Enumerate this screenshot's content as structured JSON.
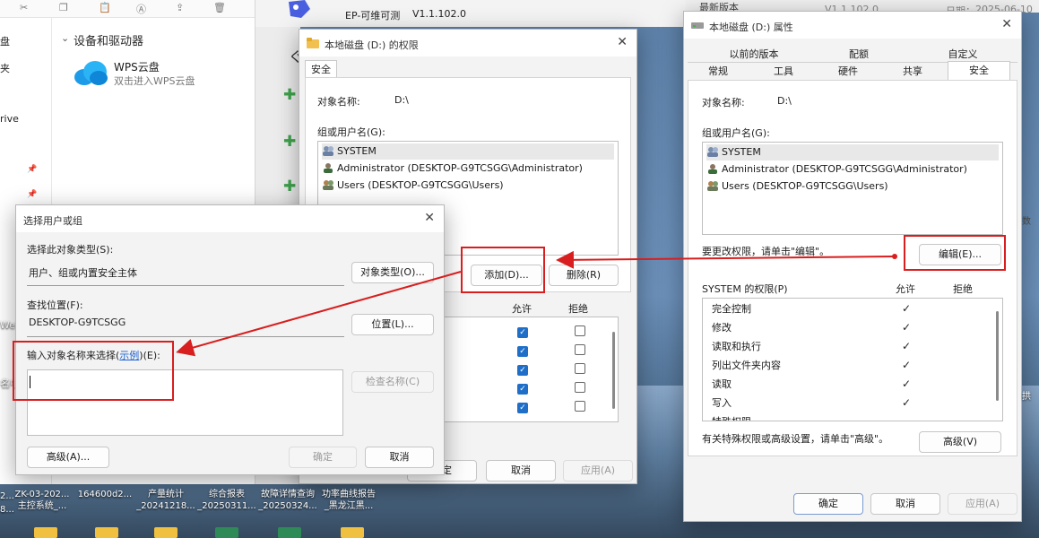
{
  "explorer": {
    "devices_header": "设备和驱动器",
    "wps_name": "WPS云盘",
    "wps_sub": "双击进入WPS云盘",
    "sidebar_items": [
      "盘",
      "夹",
      "rive",
      "Web",
      "名中"
    ]
  },
  "ep_app": {
    "title": "EP-可维可测",
    "version": "V1.1.102.0",
    "right_latest_label": "最新版本",
    "right_latest_value": "V1.1.102.0",
    "right_date_label": "日期：",
    "right_date_value": "2025-06-10"
  },
  "permissions_dialog": {
    "title": "本地磁盘 (D:) 的权限",
    "tab": "安全",
    "object_label": "对象名称:",
    "object_value": "D:\\",
    "group_label": "组或用户名(G):",
    "users": [
      "SYSTEM",
      "Administrator (DESKTOP-G9TCSGG\\Administrator)",
      "Users (DESKTOP-G9TCSGG\\Users)"
    ],
    "add_button": "添加(D)...",
    "remove_button": "删除(R)",
    "allow_header": "允许",
    "deny_header": "拒绝",
    "ok_button": "确定",
    "cancel_button": "取消",
    "apply_button": "应用(A)"
  },
  "select_dialog": {
    "title": "选择用户或组",
    "object_type_label": "选择此对象类型(S):",
    "object_type_value": "用户、组或内置安全主体",
    "object_type_button": "对象类型(O)...",
    "location_label": "查找位置(F):",
    "location_value": "DESKTOP-G9TCSGG",
    "location_button": "位置(L)...",
    "enter_label_prefix": "输入对象名称来选择(",
    "enter_label_link": "示例",
    "enter_label_suffix": ")(E):",
    "input_value": "",
    "check_names_button": "检查名称(C)",
    "advanced_button": "高级(A)...",
    "ok_button": "确定",
    "cancel_button": "取消"
  },
  "properties_dialog": {
    "title": "本地磁盘 (D:) 属性",
    "tabs_row1": [
      "以前的版本",
      "配额",
      "自定义"
    ],
    "tabs_row2": [
      "常规",
      "工具",
      "硬件",
      "共享",
      "安全"
    ],
    "object_label": "对象名称:",
    "object_value": "D:\\",
    "group_label": "组或用户名(G):",
    "users": [
      "SYSTEM",
      "Administrator (DESKTOP-G9TCSGG\\Administrator)",
      "Users (DESKTOP-G9TCSGG\\Users)"
    ],
    "edit_hint": "要更改权限，请单击\"编辑\"。",
    "edit_button": "编辑(E)...",
    "perm_title": "SYSTEM 的权限(P)",
    "allow_header": "允许",
    "deny_header": "拒绝",
    "permissions": [
      "完全控制",
      "修改",
      "读取和执行",
      "列出文件夹内容",
      "读取",
      "写入",
      "特殊权限"
    ],
    "advanced_hint": "有关特殊权限或高级设置，请单击\"高级\"。",
    "advanced_button": "高级(V)",
    "ok_button": "确定",
    "cancel_button": "取消",
    "apply_button": "应用(A)",
    "right_edge_labels": [
      "数",
      "拱"
    ]
  },
  "desktop_icons": [
    {
      "l1": "ZK-03-202...",
      "l2": "主控系统_..."
    },
    {
      "l1": "164600d2...",
      "l2": ""
    },
    {
      "l1": "产量统计",
      "l2": "_20241218..."
    },
    {
      "l1": "综合报表",
      "l2": "_20250311..."
    },
    {
      "l1": "故障详情查询",
      "l2": "_20250324..."
    },
    {
      "l1": "功率曲线报告",
      "l2": "_黑龙江黑..."
    }
  ],
  "desktop_left_edge": [
    "2...",
    "8..."
  ],
  "colors": {
    "accent_red": "#d81e1e",
    "check_blue": "#1f6fc9",
    "link_blue": "#1a5fd0"
  }
}
